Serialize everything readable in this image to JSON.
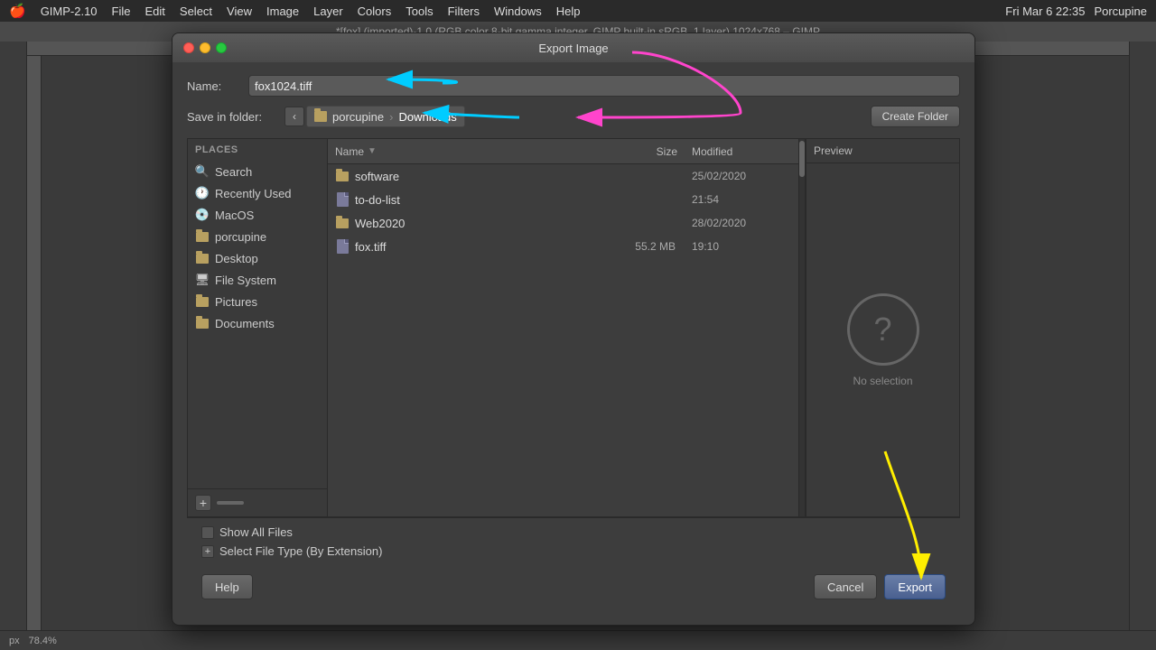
{
  "menubar": {
    "apple": "🍎",
    "items": [
      "GIMP-2.10",
      "File",
      "Edit",
      "Select",
      "View",
      "Image",
      "Layer",
      "Colors",
      "Tools",
      "Filters",
      "Windows",
      "Help"
    ],
    "right": {
      "time": "Fri Mar 6  22:35",
      "user": "Porcupine"
    }
  },
  "gimp_titlebar": {
    "text": "*[fox] (imported)-1.0 (RGB color 8-bit gamma integer, GIMP built-in sRGB, 1 layer) 1024x768 – GIMP"
  },
  "dialog": {
    "title": "Export Image",
    "name_label": "Name:",
    "name_value": "fox1024.tiff",
    "folder_label": "Save in folder:",
    "breadcrumb_parent": "porcupine",
    "breadcrumb_current": "Downloads",
    "create_folder_btn": "Create Folder",
    "places": {
      "header": "Places",
      "items": [
        {
          "id": "search",
          "label": "Search",
          "icon": "search"
        },
        {
          "id": "recently-used",
          "label": "Recently Used",
          "icon": "clock"
        },
        {
          "id": "macos",
          "label": "MacOS",
          "icon": "drive"
        },
        {
          "id": "porcupine",
          "label": "porcupine",
          "icon": "folder"
        },
        {
          "id": "desktop",
          "label": "Desktop",
          "icon": "folder"
        },
        {
          "id": "file-system",
          "label": "File System",
          "icon": "hdd"
        },
        {
          "id": "pictures",
          "label": "Pictures",
          "icon": "folder"
        },
        {
          "id": "documents",
          "label": "Documents",
          "icon": "folder"
        }
      ]
    },
    "file_columns": {
      "name": "Name",
      "size": "Size",
      "modified": "Modified"
    },
    "files": [
      {
        "name": "software",
        "size": "",
        "modified": "25/02/2020",
        "type": "folder"
      },
      {
        "name": "to-do-list",
        "size": "",
        "modified": "21:54",
        "type": "doc"
      },
      {
        "name": "Web2020",
        "size": "",
        "modified": "28/02/2020",
        "type": "folder"
      },
      {
        "name": "fox.tiff",
        "size": "55.2 MB",
        "modified": "19:10",
        "type": "doc"
      }
    ],
    "preview": {
      "header": "Preview",
      "no_selection": "No selection"
    },
    "show_all_files_label": "Show All Files",
    "select_file_type_label": "Select File Type (By Extension)",
    "buttons": {
      "help": "Help",
      "cancel": "Cancel",
      "export": "Export"
    }
  },
  "status_bar": {
    "unit": "px",
    "zoom": "78.4%"
  }
}
